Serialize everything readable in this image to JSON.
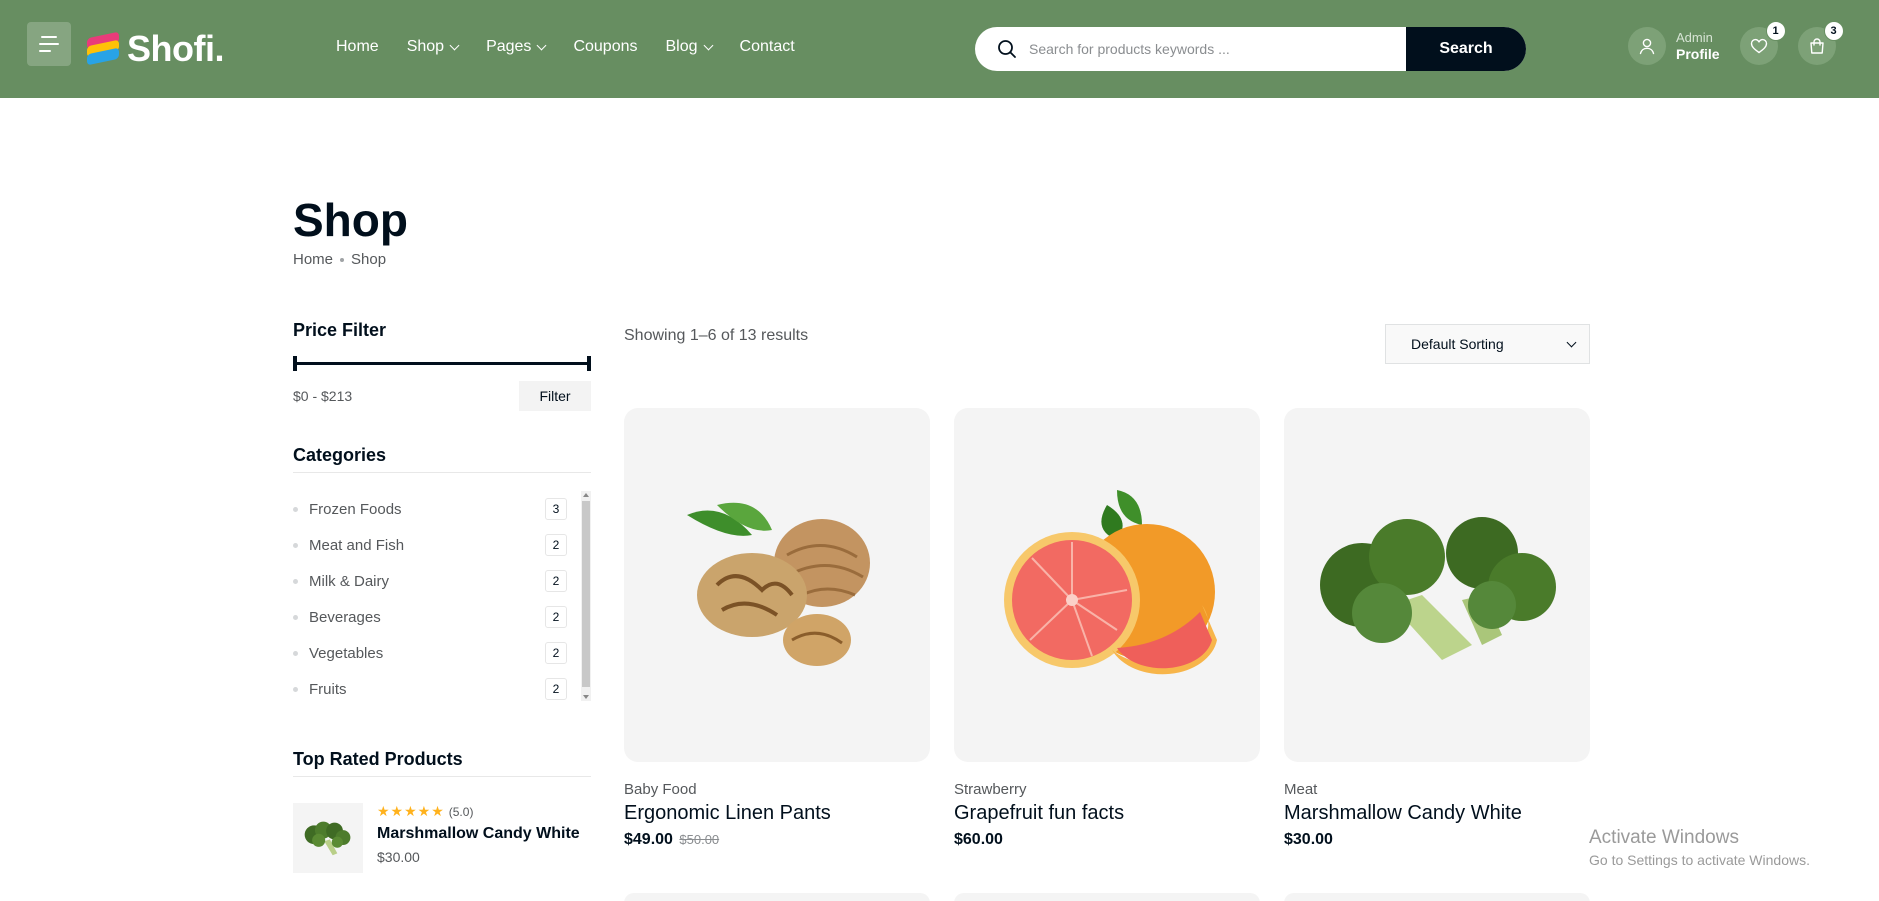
{
  "brand": {
    "name": "Shofi."
  },
  "nav": {
    "items": [
      {
        "label": "Home",
        "dropdown": false
      },
      {
        "label": "Shop",
        "dropdown": true
      },
      {
        "label": "Pages",
        "dropdown": true
      },
      {
        "label": "Coupons",
        "dropdown": false
      },
      {
        "label": "Blog",
        "dropdown": true
      },
      {
        "label": "Contact",
        "dropdown": false
      }
    ]
  },
  "search": {
    "placeholder": "Search for products keywords ...",
    "button_label": "Search"
  },
  "account": {
    "greeting": "Admin",
    "label": "Profile"
  },
  "wishlist": {
    "count": "1"
  },
  "cart": {
    "count": "3"
  },
  "page": {
    "title": "Shop",
    "breadcrumb": [
      "Home",
      "Shop"
    ]
  },
  "sidebar": {
    "price_filter": {
      "title": "Price Filter",
      "range_text": "$0 - $213",
      "filter_label": "Filter",
      "min": 0,
      "max": 213
    },
    "categories": {
      "title": "Categories",
      "items": [
        {
          "name": "Frozen Foods",
          "count": "3"
        },
        {
          "name": "Meat and Fish",
          "count": "2"
        },
        {
          "name": "Milk & Dairy",
          "count": "2"
        },
        {
          "name": "Beverages",
          "count": "2"
        },
        {
          "name": "Vegetables",
          "count": "2"
        },
        {
          "name": "Fruits",
          "count": "2"
        }
      ]
    },
    "top_rated": {
      "title": "Top Rated Products",
      "items": [
        {
          "stars": "★★★★★",
          "rating": "(5.0)",
          "name": "Marshmallow Candy White",
          "price": "$30.00",
          "image": "broccoli-icon"
        }
      ]
    }
  },
  "results": {
    "showing_text": "Showing 1–6 of 13 results",
    "sort_selected": "Default Sorting"
  },
  "products": [
    {
      "category": "Baby Food",
      "title": "Ergonomic Linen Pants",
      "price": "$49.00",
      "old_price": "$50.00",
      "image": "walnut-icon"
    },
    {
      "category": "Strawberry",
      "title": "Grapefruit fun facts",
      "price": "$60.00",
      "old_price": "",
      "image": "grapefruit-icon"
    },
    {
      "category": "Meat",
      "title": "Marshmallow Candy White",
      "price": "$30.00",
      "old_price": "",
      "image": "broccoli-icon"
    }
  ],
  "os_notice": {
    "line1": "Activate Windows",
    "line2": "Go to Settings to activate Windows."
  },
  "colors": {
    "header_bg": "#678e61",
    "dark": "#010f1c",
    "star": "#ffb21d"
  }
}
